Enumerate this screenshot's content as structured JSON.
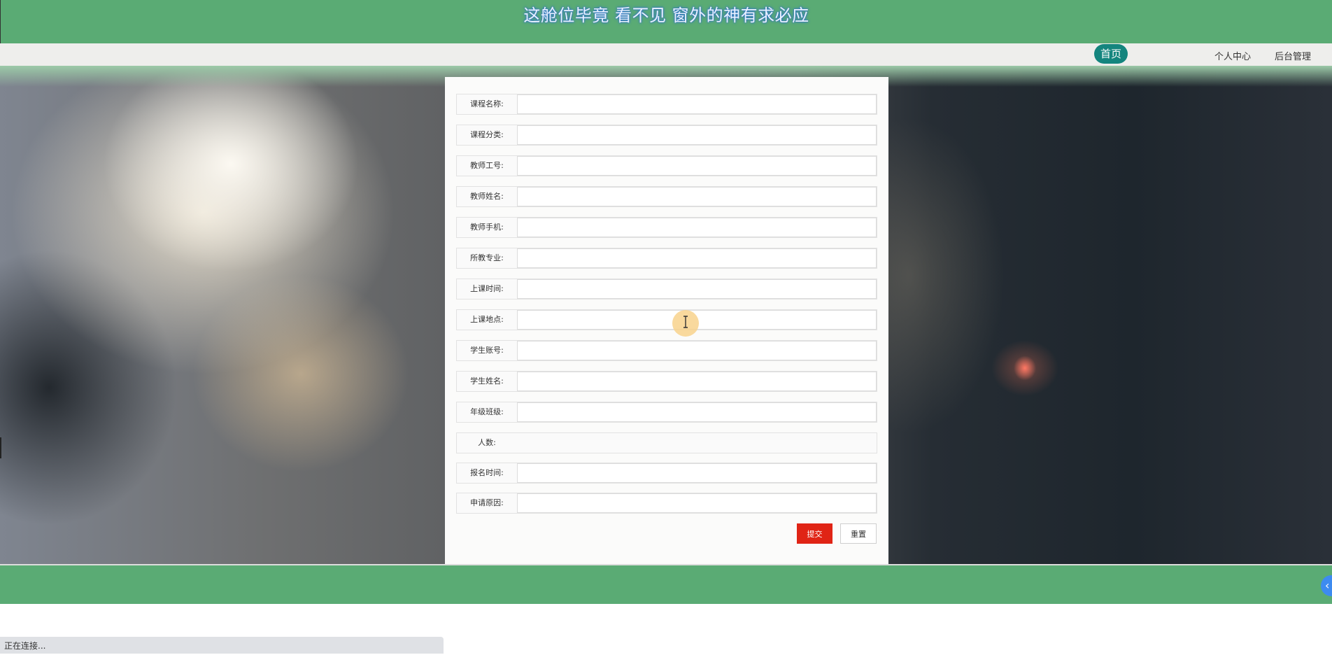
{
  "header": {
    "site_title": "这舱位毕竟 看不见 窗外的神有求必应",
    "nav": {
      "home": "首页",
      "personal_center": "个人中心",
      "admin": "后台管理"
    }
  },
  "form": {
    "fields": [
      {
        "label": "课程名称:",
        "value": ""
      },
      {
        "label": "课程分类:",
        "value": ""
      },
      {
        "label": "教师工号:",
        "value": ""
      },
      {
        "label": "教师姓名:",
        "value": ""
      },
      {
        "label": "教师手机:",
        "value": ""
      },
      {
        "label": "所教专业:",
        "value": ""
      },
      {
        "label": "上课时间:",
        "value": ""
      },
      {
        "label": "上课地点:",
        "value": ""
      },
      {
        "label": "学生账号:",
        "value": ""
      },
      {
        "label": "学生姓名:",
        "value": ""
      },
      {
        "label": "年级班级:",
        "value": ""
      },
      {
        "label": "人数:",
        "value": ""
      },
      {
        "label": "报名时间:",
        "value": ""
      },
      {
        "label": "申请原因:",
        "value": ""
      }
    ],
    "submit_label": "提交",
    "reset_label": "重置"
  },
  "status_bar": {
    "text": "正在连接..."
  },
  "colors": {
    "header_bg": "#5aab74",
    "nav_active": "#14857e",
    "submit_bg": "#e02415"
  },
  "icons": {
    "text_cursor": "i-beam-cursor-icon",
    "floating": "chevron-left-icon"
  }
}
